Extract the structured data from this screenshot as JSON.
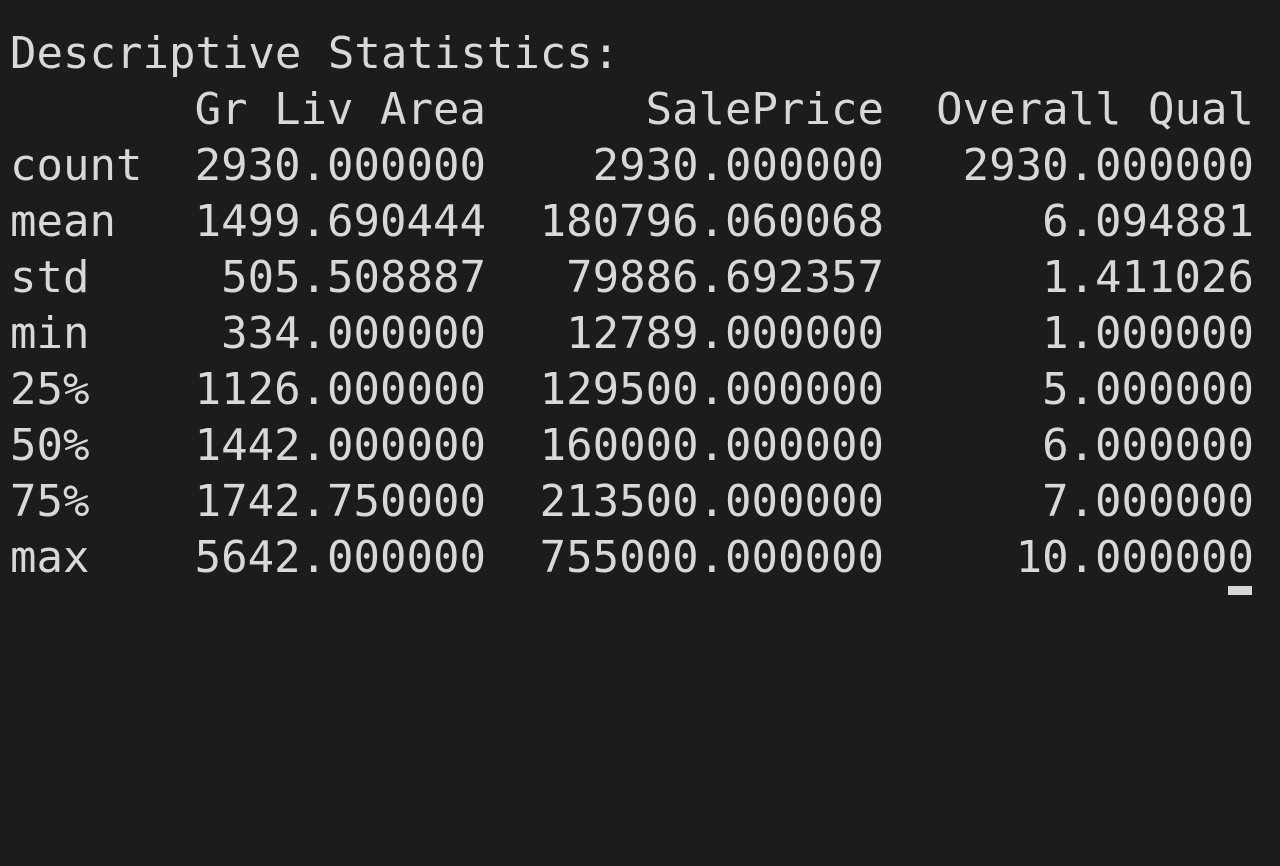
{
  "terminal": {
    "heading": "Descriptive Statistics:",
    "columns": [
      "Gr Liv Area",
      "SalePrice",
      "Overall Qual"
    ],
    "rows": [
      {
        "index": "count",
        "values": [
          "2930.000000",
          "2930.000000",
          "2930.000000"
        ]
      },
      {
        "index": "mean",
        "values": [
          "1499.690444",
          "180796.060068",
          "6.094881"
        ]
      },
      {
        "index": "std",
        "values": [
          "505.508887",
          "79886.692357",
          "1.411026"
        ]
      },
      {
        "index": "min",
        "values": [
          "334.000000",
          "12789.000000",
          "1.000000"
        ]
      },
      {
        "index": "25%",
        "values": [
          "1126.000000",
          "129500.000000",
          "5.000000"
        ]
      },
      {
        "index": "50%",
        "values": [
          "1442.000000",
          "160000.000000",
          "6.000000"
        ]
      },
      {
        "index": "75%",
        "values": [
          "1742.750000",
          "213500.000000",
          "7.000000"
        ]
      },
      {
        "index": "max",
        "values": [
          "5642.000000",
          "755000.000000",
          "10.000000"
        ]
      }
    ]
  },
  "colors": {
    "background": "#1c1c1c",
    "foreground": "#d8d8d8"
  }
}
